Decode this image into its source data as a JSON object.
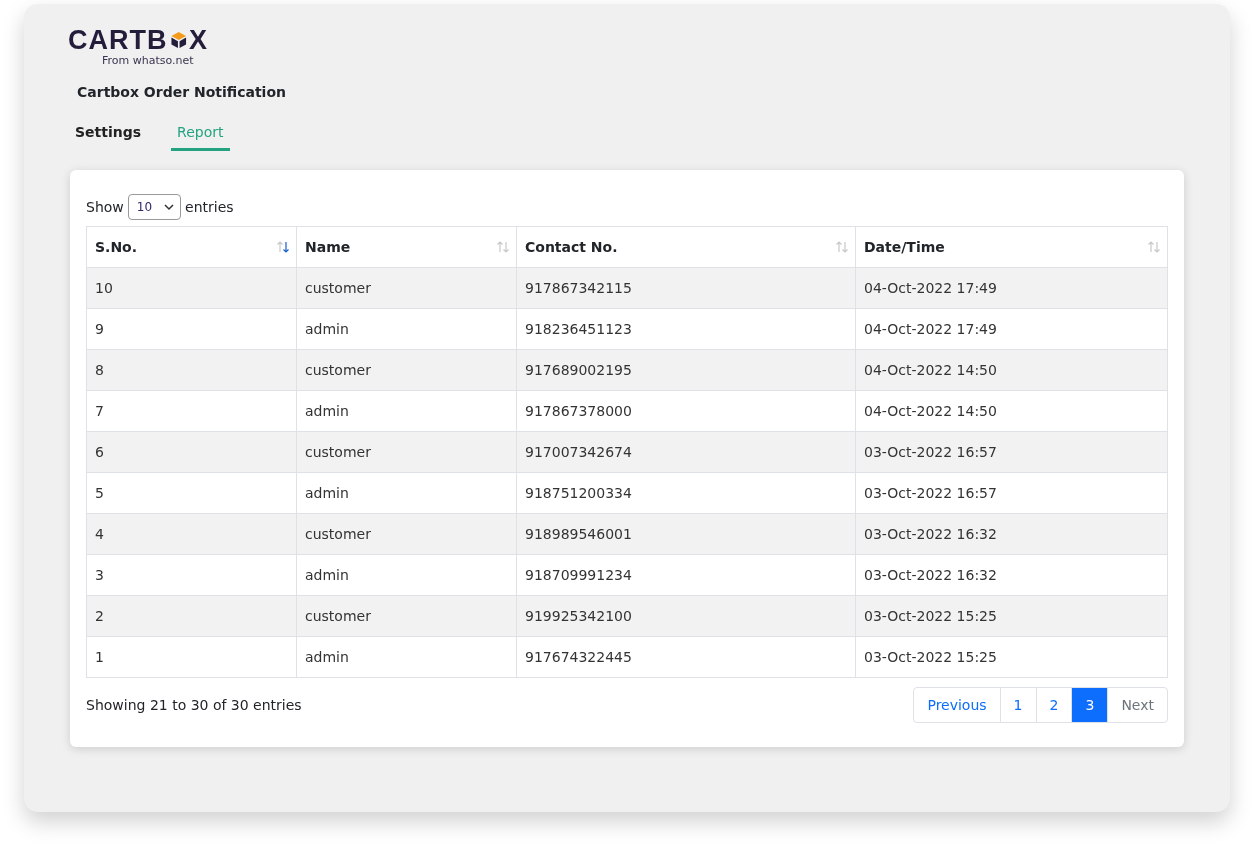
{
  "logo": {
    "left": "CARTB",
    "right": "X",
    "tagline": "From whatso.net"
  },
  "title": "Cartbox Order Notification",
  "tabs": [
    {
      "label": "Settings",
      "selected": false
    },
    {
      "label": "Report",
      "selected": true
    }
  ],
  "length_menu": {
    "before": "Show",
    "value": "10",
    "after": "entries"
  },
  "table": {
    "columns": [
      {
        "label": "S.No.",
        "sorted": true
      },
      {
        "label": "Name",
        "sorted": false
      },
      {
        "label": "Contact No.",
        "sorted": false
      },
      {
        "label": "Date/Time",
        "sorted": false
      }
    ],
    "rows": [
      [
        "10",
        "customer",
        "917867342115",
        "04-Oct-2022 17:49"
      ],
      [
        "9",
        "admin",
        "918236451123",
        "04-Oct-2022 17:49"
      ],
      [
        "8",
        "customer",
        "917689002195",
        "04-Oct-2022 14:50"
      ],
      [
        "7",
        "admin",
        "917867378000",
        "04-Oct-2022 14:50"
      ],
      [
        "6",
        "customer",
        "917007342674",
        "03-Oct-2022 16:57"
      ],
      [
        "5",
        "admin",
        "918751200334",
        "03-Oct-2022 16:57"
      ],
      [
        "4",
        "customer",
        "918989546001",
        "03-Oct-2022 16:32"
      ],
      [
        "3",
        "admin",
        "918709991234",
        "03-Oct-2022 16:32"
      ],
      [
        "2",
        "customer",
        "919925342100",
        "03-Oct-2022 15:25"
      ],
      [
        "1",
        "admin",
        "917674322445",
        "03-Oct-2022 15:25"
      ]
    ]
  },
  "info": "Showing 21 to 30 of 30 entries",
  "pagination": [
    {
      "label": "Previous",
      "selected": false,
      "disabled": false
    },
    {
      "label": "1",
      "selected": false,
      "disabled": false
    },
    {
      "label": "2",
      "selected": false,
      "disabled": false
    },
    {
      "label": "3",
      "selected": true,
      "disabled": false
    },
    {
      "label": "Next",
      "selected": false,
      "disabled": true
    }
  ]
}
